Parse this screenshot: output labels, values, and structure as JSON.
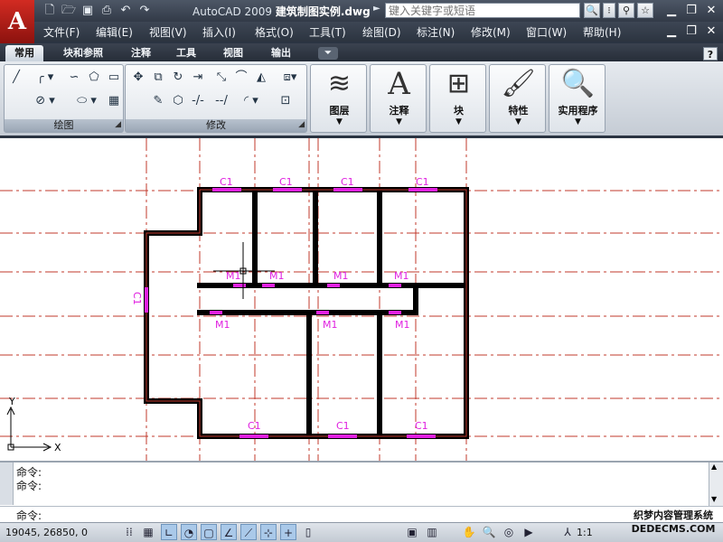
{
  "app": {
    "title_app": "AutoCAD 2009",
    "title_file": "建筑制图实例.dwg",
    "logo_letter": "A"
  },
  "search": {
    "placeholder": "键入关键字或短语"
  },
  "menu": [
    "文件(F)",
    "编辑(E)",
    "视图(V)",
    "插入(I)",
    "格式(O)",
    "工具(T)",
    "绘图(D)",
    "标注(N)",
    "修改(M)",
    "窗口(W)",
    "帮助(H)"
  ],
  "tabs": [
    "常用",
    "块和参照",
    "注释",
    "工具",
    "视图",
    "输出"
  ],
  "help_label": "?",
  "panels": {
    "draw_label": "绘图",
    "modify_label": "修改",
    "layers_label": "图层",
    "annotate_label": "注释",
    "block_label": "块",
    "properties_label": "特性",
    "utilities_label": "实用程序",
    "annotate_icon": "A"
  },
  "drawing": {
    "window_labels": [
      "C1",
      "C1",
      "C1",
      "C1",
      "C1",
      "C1",
      "C1",
      "C1"
    ],
    "door_labels": [
      "M1",
      "M1",
      "M1",
      "M1",
      "M1",
      "M1",
      "M1"
    ],
    "axis_x": "X",
    "axis_y": "Y"
  },
  "command": {
    "lines": [
      "命令:",
      "命令:"
    ],
    "prompt": "命令:"
  },
  "status": {
    "coords": "19045, 26850, 0",
    "scale": "1:1"
  },
  "watermark": {
    "line1": "织梦内容管理系统",
    "line2": "DEDECMS.COM"
  },
  "colors": {
    "axis_line": "#c0392b",
    "wall": "#000000",
    "label_magenta": "#e020e0"
  }
}
